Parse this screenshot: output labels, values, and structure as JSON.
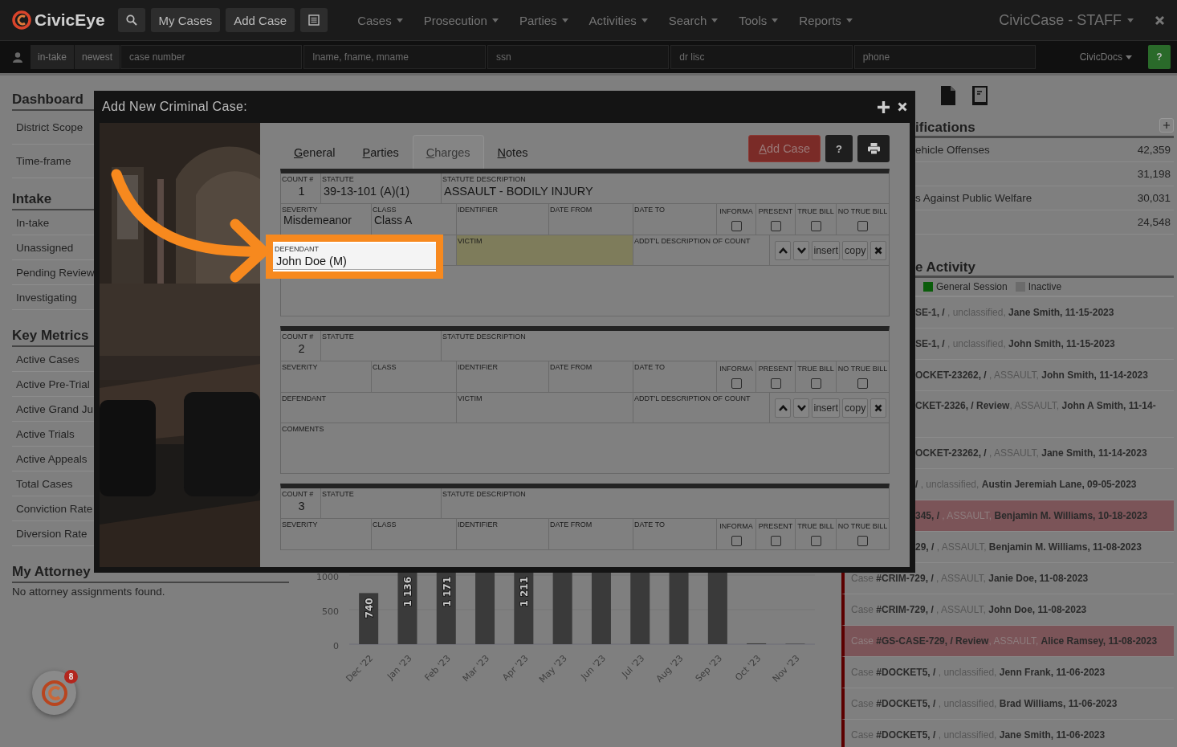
{
  "navbar": {
    "logo": "CivicEye",
    "buttons": [
      "My Cases",
      "Add Case"
    ],
    "menus": [
      "Cases",
      "Prosecution",
      "Parties",
      "Activities",
      "Search",
      "Tools",
      "Reports"
    ],
    "title": "CivicCase - STAFF"
  },
  "search_bar": {
    "filters": [
      "in-take",
      "newest"
    ],
    "fields": [
      {
        "placeholder": "case number"
      },
      {
        "placeholder": "lname, fname, mname"
      },
      {
        "placeholder": "ssn"
      },
      {
        "placeholder": "dr lisc"
      },
      {
        "placeholder": "phone"
      }
    ],
    "docs": "CivicDocs",
    "help": "?"
  },
  "sidebar": [
    {
      "title": "Dashboard",
      "items": [
        {
          "label": "District Scope",
          "kind": "filter"
        },
        {
          "label": "Time-frame",
          "kind": "filter"
        }
      ]
    },
    {
      "title": "Intake",
      "items": [
        {
          "label": "In-take",
          "kind": "link"
        },
        {
          "label": "Unassigned",
          "kind": "link"
        },
        {
          "label": "Pending Review",
          "kind": "link"
        },
        {
          "label": "Investigating",
          "kind": "link"
        }
      ]
    },
    {
      "title": "Key Metrics",
      "items": [
        {
          "label": "Active Cases",
          "kind": "link"
        },
        {
          "label": "Active Pre-Trial",
          "kind": "link"
        },
        {
          "label": "Active Grand Ju",
          "kind": "link"
        },
        {
          "label": "Active Trials",
          "kind": "link"
        },
        {
          "label": "Active Appeals",
          "kind": "link"
        },
        {
          "label": "Total Cases",
          "kind": "link"
        },
        {
          "label": "Conviction Rate",
          "kind": "link"
        },
        {
          "label": "Diversion Rate",
          "kind": "link"
        }
      ]
    },
    {
      "title": "My Attorney",
      "note": "No attorney assignments found."
    }
  ],
  "chart": {
    "yticks": [
      "1000",
      "500",
      "0"
    ],
    "bars": [
      {
        "category": "Dec '22",
        "label": "740"
      },
      {
        "category": "Jan '23",
        "label": "1 136"
      },
      {
        "category": "Feb '23",
        "label": "1 171"
      },
      {
        "category": "Mar '23"
      },
      {
        "category": "Apr '23",
        "label": "1 211"
      },
      {
        "category": "May '23"
      },
      {
        "category": "Jun '23"
      },
      {
        "category": "Jul '23"
      },
      {
        "category": "Aug '23"
      },
      {
        "category": "Sep '23"
      },
      {
        "category": "Oct '23"
      },
      {
        "category": "Nov '23"
      }
    ]
  },
  "classifications": {
    "title": "ifications",
    "rows": [
      {
        "label": "ehicle Offenses",
        "count": "42,359"
      },
      {
        "count": "31,198"
      },
      {
        "label": "s Against Public Welfare",
        "count": "30,031"
      },
      {
        "count": "24,548"
      }
    ]
  },
  "activity": {
    "title": "e Activity",
    "legend": [
      {
        "label": "General Session",
        "color": "#0a5c0a"
      },
      {
        "label": "Inactive",
        "color": "#6b6b6b"
      }
    ],
    "rows": [
      {
        "text": "**SE-1, /** , unclassified, **Jane Smith, 11-15-2023**",
        "highlighted": false,
        "wrapped": false
      },
      {
        "text": "**SE-1, /** , unclassified, **John Smith, 11-15-2023**",
        "highlighted": false,
        "wrapped": false
      },
      {
        "text": "**OCKET-23262, /** , ASSAULT, **John Smith, 11-14-2023**",
        "highlighted": false,
        "wrapped": false
      },
      {
        "text": "**CKET-2326, / Review**, ASSAULT, **John A Smith, 11-14-**",
        "highlighted": false,
        "wrapped": true
      },
      {
        "text": "**OCKET-23262, /** , ASSAULT, **Jane Smith, 11-14-2023**",
        "highlighted": false,
        "wrapped": false
      },
      {
        "text": "**/** , unclassified, **Austin Jeremiah Lane, 09-05-2023**",
        "highlighted": false,
        "wrapped": false
      },
      {
        "text": "**345, /** , ASSAULT, **Benjamin M. Williams, 10-18-2023**",
        "highlighted": true,
        "wrapped": false
      },
      {
        "text": "**29, /** , ASSAULT, **Benjamin M. Williams, 11-08-2023**",
        "highlighted": false,
        "wrapped": false
      },
      {
        "text": "Case **#CRIM-729, /** , ASSAULT, **Janie Doe, 11-08-2023**",
        "highlighted": false,
        "wrapped": false
      },
      {
        "text": "Case **#CRIM-729, /** , ASSAULT, **John Doe, 11-08-2023**",
        "highlighted": false,
        "wrapped": false
      },
      {
        "text": "Case **#GS-CASE-729, / Review**, ASSAULT, **Alice Ramsey, 11-08-2023**",
        "highlighted": true,
        "wrapped": false
      },
      {
        "text": "Case **#DOCKET5, /** , unclassified, **Jenn Frank, 11-06-2023**",
        "highlighted": false,
        "wrapped": false
      },
      {
        "text": "Case **#DOCKET5, /** , unclassified, **Brad Williams, 11-06-2023**",
        "highlighted": false,
        "wrapped": false
      },
      {
        "text": "Case **#DOCKET5, /** , unclassified, **Jane Smith, 11-06-2023**",
        "highlighted": false,
        "wrapped": false
      }
    ]
  },
  "modal": {
    "title": "Add New Criminal Case:",
    "tabs": [
      {
        "label": "General",
        "selected": false
      },
      {
        "label": "Parties",
        "selected": false
      },
      {
        "label": "Charges",
        "selected": true
      },
      {
        "label": "Notes",
        "selected": false
      }
    ],
    "add_button": "Add Case",
    "help_button": "?",
    "counts": [
      {
        "lines": [
          {
            "kind": "head",
            "fields": [
              {
                "kind": "number",
                "label": "COUNT #",
                "value": "1"
              },
              {
                "kind": "field",
                "label": "STATUTE",
                "value": "39-13-101 (A)(1)"
              },
              {
                "kind": "field",
                "label": "STATUTE DESCRIPTION",
                "value": "ASSAULT -  BODILY INJURY"
              }
            ]
          },
          {
            "kind": "dates",
            "fields": [
              {
                "kind": "field",
                "label": "SEVERITY",
                "value": "Misdemeanor"
              },
              {
                "kind": "field",
                "label": "CLASS",
                "value": "Class A"
              },
              {
                "kind": "field",
                "label": "IDENTIFIER"
              },
              {
                "kind": "field",
                "label": "DATE FROM"
              },
              {
                "kind": "field",
                "label": "DATE TO"
              },
              {
                "kind": "check",
                "label": "INFORMA",
                "checked": false
              },
              {
                "kind": "check",
                "label": "PRESENT",
                "checked": false
              },
              {
                "kind": "check",
                "label": "TRUE BILL",
                "checked": false
              },
              {
                "kind": "check",
                "label": "NO TRUE BILL",
                "checked": false
              }
            ]
          },
          {
            "kind": "parties",
            "fields": [
              {
                "kind": "spotlight",
                "label": "DEFENDANT",
                "value": "John Doe (M)"
              },
              {
                "kind": "marked",
                "label": "VICTIM"
              },
              {
                "kind": "field",
                "label": "ADDT'L DESCRIPTION OF COUNT"
              },
              {
                "kind": "actions",
                "buttons": [
                  {
                    "kind": "up"
                  },
                  {
                    "kind": "down"
                  },
                  {
                    "kind": "text",
                    "label": "insert"
                  },
                  {
                    "kind": "text",
                    "label": "copy"
                  },
                  {
                    "kind": "remove"
                  }
                ]
              }
            ]
          },
          {
            "kind": "comments",
            "fields": [
              {
                "kind": "field"
              }
            ]
          }
        ]
      },
      {
        "lines": [
          {
            "kind": "head",
            "fields": [
              {
                "kind": "number",
                "label": "COUNT #",
                "value": "2"
              },
              {
                "kind": "field",
                "label": "STATUTE"
              },
              {
                "kind": "field",
                "label": "STATUTE DESCRIPTION"
              }
            ]
          },
          {
            "kind": "dates",
            "fields": [
              {
                "kind": "field",
                "label": "SEVERITY"
              },
              {
                "kind": "field",
                "label": "CLASS"
              },
              {
                "kind": "field",
                "label": "IDENTIFIER"
              },
              {
                "kind": "field",
                "label": "DATE FROM"
              },
              {
                "kind": "field",
                "label": "DATE TO"
              },
              {
                "kind": "check",
                "label": "INFORMA",
                "checked": false
              },
              {
                "kind": "check",
                "label": "PRESENT",
                "checked": false
              },
              {
                "kind": "check",
                "label": "TRUE BILL",
                "checked": false
              },
              {
                "kind": "check",
                "label": "NO TRUE BILL",
                "checked": false
              }
            ]
          },
          {
            "kind": "parties",
            "fields": [
              {
                "kind": "field",
                "label": "DEFENDANT"
              },
              {
                "kind": "field",
                "label": "VICTIM"
              },
              {
                "kind": "field",
                "label": "ADDT'L DESCRIPTION OF COUNT"
              },
              {
                "kind": "actions",
                "buttons": [
                  {
                    "kind": "up"
                  },
                  {
                    "kind": "down"
                  },
                  {
                    "kind": "text",
                    "label": "insert"
                  },
                  {
                    "kind": "text",
                    "label": "copy"
                  },
                  {
                    "kind": "remove"
                  }
                ]
              }
            ]
          },
          {
            "kind": "comments",
            "fields": [
              {
                "kind": "field",
                "label": "COMMENTS"
              }
            ]
          }
        ]
      },
      {
        "lines": [
          {
            "kind": "head",
            "fields": [
              {
                "kind": "number",
                "label": "COUNT #",
                "value": "3"
              },
              {
                "kind": "field",
                "label": "STATUTE"
              },
              {
                "kind": "field",
                "label": "STATUTE DESCRIPTION"
              }
            ]
          },
          {
            "kind": "dates",
            "fields": [
              {
                "kind": "field",
                "label": "SEVERITY"
              },
              {
                "kind": "field",
                "label": "CLASS"
              },
              {
                "kind": "field",
                "label": "IDENTIFIER"
              },
              {
                "kind": "field",
                "label": "DATE FROM"
              },
              {
                "kind": "field",
                "label": "DATE TO"
              },
              {
                "kind": "check",
                "label": "INFORMA",
                "checked": false
              },
              {
                "kind": "check",
                "label": "PRESENT",
                "checked": false
              },
              {
                "kind": "check",
                "label": "TRUE BILL",
                "checked": false
              },
              {
                "kind": "check",
                "label": "NO TRUE BILL",
                "checked": false
              }
            ]
          }
        ]
      }
    ]
  },
  "launcher": {
    "badge": "8"
  }
}
